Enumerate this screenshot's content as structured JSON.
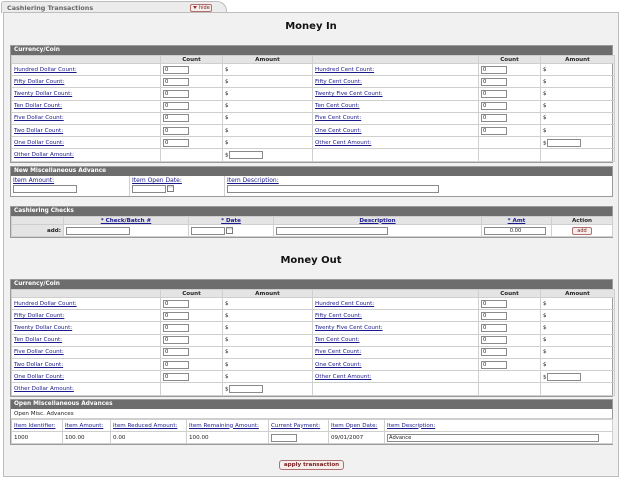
{
  "tab": {
    "title": "Cashiering Transactions",
    "hide_label": "hide"
  },
  "money_in": {
    "heading": "Money In",
    "currency": {
      "header": "Currency/Coin",
      "col_count": "Count",
      "col_amount": "Amount",
      "left_rows": [
        {
          "label": "Hundred Dollar Count:",
          "count": "0",
          "amount": "$"
        },
        {
          "label": "Fifty Dollar Count:",
          "count": "0",
          "amount": "$"
        },
        {
          "label": "Twenty Dollar Count:",
          "count": "0",
          "amount": "$"
        },
        {
          "label": "Ten Dollar Count:",
          "count": "0",
          "amount": "$"
        },
        {
          "label": "Five Dollar Count:",
          "count": "0",
          "amount": "$"
        },
        {
          "label": "Two Dollar Count:",
          "count": "0",
          "amount": "$"
        },
        {
          "label": "One Dollar Count:",
          "count": "0",
          "amount": "$"
        },
        {
          "label": "Other Dollar Amount:",
          "count": "",
          "amount": "$"
        }
      ],
      "right_rows": [
        {
          "label": "Hundred Cent Count:",
          "count": "0",
          "amount": "$"
        },
        {
          "label": "Fifty Cent Count:",
          "count": "0",
          "amount": "$"
        },
        {
          "label": "Twenty Five Cent Count:",
          "count": "0",
          "amount": "$"
        },
        {
          "label": "Ten Cent Count:",
          "count": "0",
          "amount": "$"
        },
        {
          "label": "Five Cent Count:",
          "count": "0",
          "amount": "$"
        },
        {
          "label": "One Cent Count:",
          "count": "0",
          "amount": "$"
        },
        {
          "label": "Other Cent Amount:",
          "count": "",
          "amount": "$"
        }
      ]
    },
    "misc_advance": {
      "header": "New Miscellaneous Advance",
      "item_amount_label": "Item Amount:",
      "item_open_date_label": "Item Open Date:",
      "item_description_label": "Item Description:"
    },
    "checks": {
      "header": "Cashiering Checks",
      "col_check": "* Check/Batch #",
      "col_date": "* Date",
      "col_description": "Description",
      "col_amt": "* Amt",
      "col_action": "Action",
      "add_label": "add:",
      "amt_value": "0.00",
      "add_button": "add"
    }
  },
  "money_out": {
    "heading": "Money Out",
    "currency": {
      "header": "Currency/Coin",
      "col_count": "Count",
      "col_amount": "Amount",
      "left_rows": [
        {
          "label": "Hundred Dollar Count:",
          "count": "0",
          "amount": "$"
        },
        {
          "label": "Fifty Dollar Count:",
          "count": "0",
          "amount": "$"
        },
        {
          "label": "Twenty Dollar Count:",
          "count": "0",
          "amount": "$"
        },
        {
          "label": "Ten Dollar Count:",
          "count": "0",
          "amount": "$"
        },
        {
          "label": "Five Dollar Count:",
          "count": "0",
          "amount": "$"
        },
        {
          "label": "Two Dollar Count:",
          "count": "0",
          "amount": "$"
        },
        {
          "label": "One Dollar Count:",
          "count": "0",
          "amount": "$"
        },
        {
          "label": "Other Dollar Amount:",
          "count": "",
          "amount": "$"
        }
      ],
      "right_rows": [
        {
          "label": "Hundred Cent Count:",
          "count": "0",
          "amount": "$"
        },
        {
          "label": "Fifty Cent Count:",
          "count": "0",
          "amount": "$"
        },
        {
          "label": "Twenty Five Cent Count:",
          "count": "0",
          "amount": "$"
        },
        {
          "label": "Ten Cent Count:",
          "count": "0",
          "amount": "$"
        },
        {
          "label": "Five Cent Count:",
          "count": "0",
          "amount": "$"
        },
        {
          "label": "One Cent Count:",
          "count": "0",
          "amount": "$"
        },
        {
          "label": "Other Cent Amount:",
          "count": "",
          "amount": "$"
        }
      ]
    },
    "open_advances": {
      "header": "Open Miscellaneous Advances",
      "subheader": "Open Misc. Advances",
      "columns": [
        "Item Identifier:",
        "Item Amount:",
        "Item Reduced Amount:",
        "Item Remaining Amount:",
        "Current Payment:",
        "Item Open Date:",
        "Item Description:"
      ],
      "row": {
        "identifier": "1000",
        "amount": "100.00",
        "reduced": "0.00",
        "remaining": "100.00",
        "payment": "",
        "open_date": "09/01/2007",
        "description": "Advance"
      }
    }
  },
  "apply_button": "apply transaction",
  "colors": {
    "section_header": "#6d6d6d",
    "link": "#1a1a8c",
    "button_border": "#b07070"
  }
}
